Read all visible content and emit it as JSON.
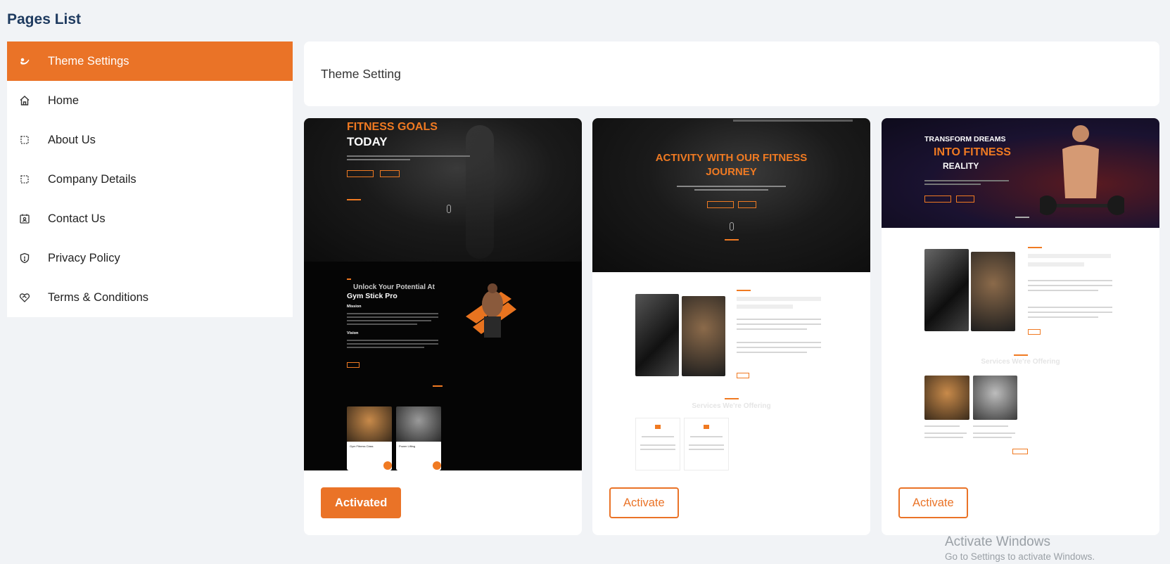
{
  "page": {
    "title": "Pages List"
  },
  "sidebar": {
    "items": [
      {
        "label": "Theme Settings",
        "icon": "theme-icon",
        "active": true
      },
      {
        "label": "Home",
        "icon": "home-icon",
        "active": false
      },
      {
        "label": "About Us",
        "icon": "page-icon",
        "active": false
      },
      {
        "label": "Company Details",
        "icon": "page-icon",
        "active": false
      },
      {
        "label": "Contact Us",
        "icon": "contact-icon",
        "active": false
      },
      {
        "label": "Privacy Policy",
        "icon": "shield-icon",
        "active": false
      },
      {
        "label": "Terms & Conditions",
        "icon": "handshake-icon",
        "active": false
      }
    ]
  },
  "main": {
    "header": "Theme Setting",
    "themes": [
      {
        "button": "Activated",
        "state": "activated",
        "preview": {
          "hero_line1": "FITNESS GOALS",
          "hero_line2": "TODAY",
          "about_heading1": "Unlock Your Potential At",
          "about_heading2": "Gym Stick Pro",
          "mission": "Mission",
          "vision": "Vision",
          "service1": "Gym Fitness Class",
          "service2": "Power Lifting"
        }
      },
      {
        "button": "Activate",
        "state": "inactive",
        "preview": {
          "hero_line1": "ACTIVITY WITH OUR FITNESS",
          "hero_line2": "JOURNEY",
          "section_title": "Services We're Offering"
        }
      },
      {
        "button": "Activate",
        "state": "inactive",
        "preview": {
          "hero_line1": "TRANSFORM DREAMS",
          "hero_line2": "INTO FITNESS",
          "hero_line3": "REALITY",
          "section_title": "Services We're Offering"
        }
      }
    ]
  },
  "watermark": {
    "line1": "Activate Windows",
    "line2": "Go to Settings to activate Windows."
  },
  "colors": {
    "accent": "#ea7327",
    "background": "#f1f3f6"
  }
}
